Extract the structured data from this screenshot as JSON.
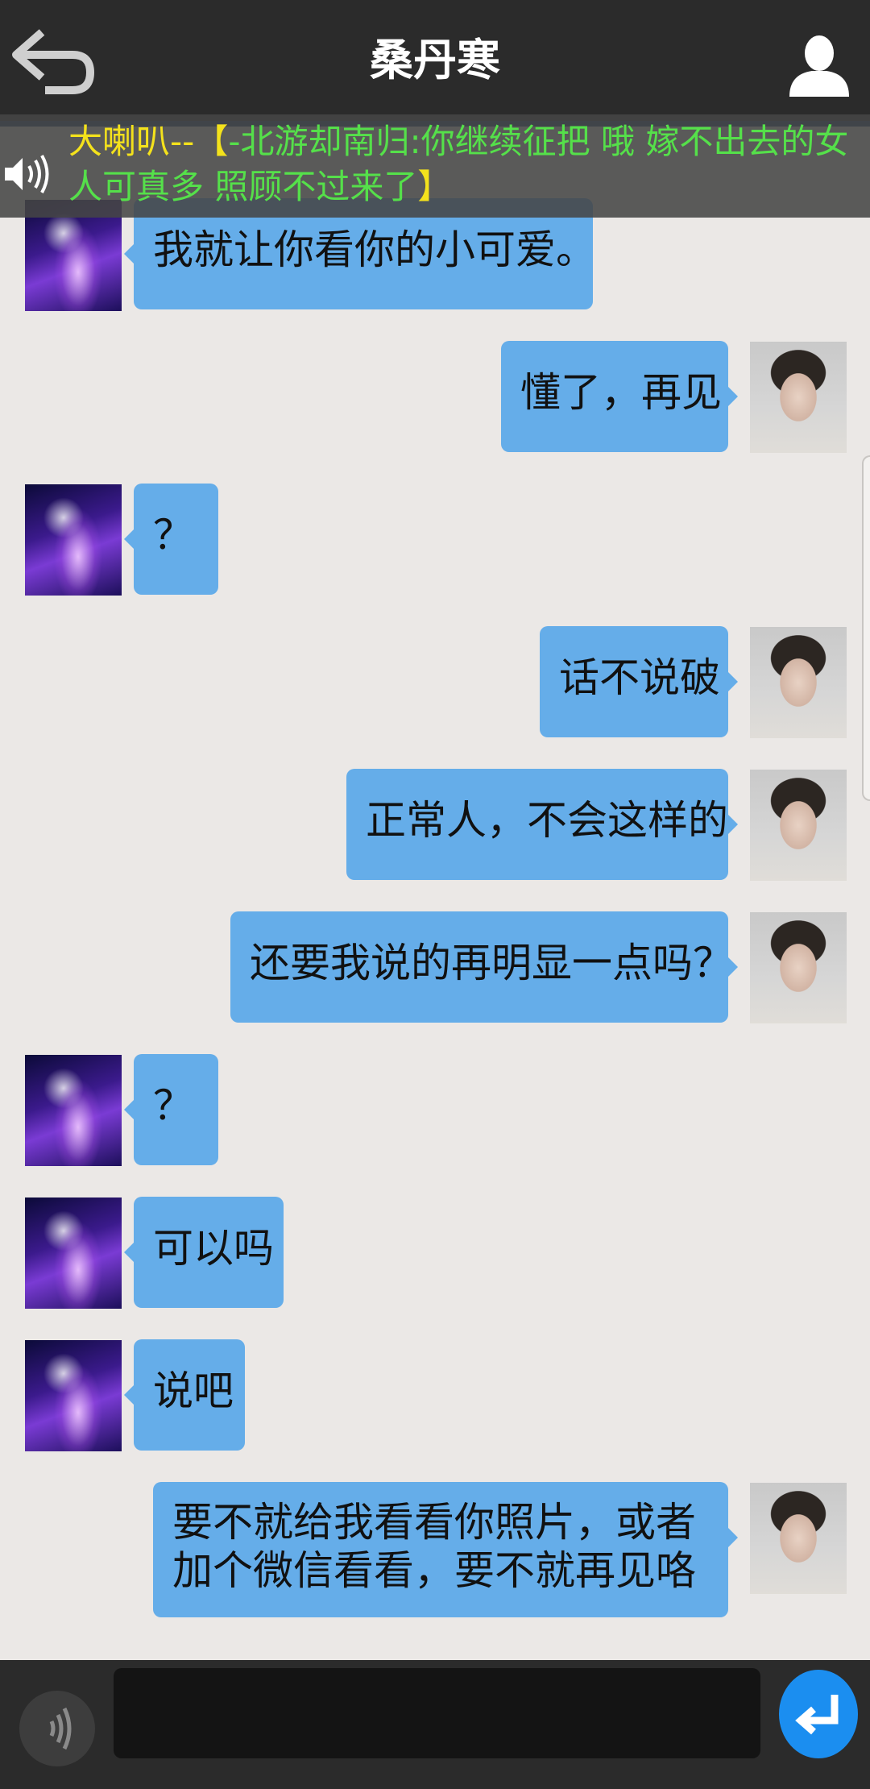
{
  "header": {
    "title": "桑丹寒",
    "back_icon": "back-arrow-icon",
    "profile_icon": "user-profile-icon"
  },
  "banner": {
    "prefix": "大喇叭--",
    "open_bracket": "【",
    "message": "-北游却南归:你继续征把 哦 嫁不出去的女人可真多 照顾不过来了",
    "close_bracket": "】",
    "icon": "speaker-icon"
  },
  "messages": [
    {
      "side": "left",
      "text": "我就让你看你的小可爱。"
    },
    {
      "side": "right",
      "text": "懂了，再见"
    },
    {
      "side": "left",
      "text": "？"
    },
    {
      "side": "right",
      "text": "话不说破"
    },
    {
      "side": "right",
      "text": "正常人，不会这样的"
    },
    {
      "side": "right",
      "text": "还要我说的再明显一点吗？"
    },
    {
      "side": "left",
      "text": "？"
    },
    {
      "side": "left",
      "text": "可以吗"
    },
    {
      "side": "left",
      "text": "说吧"
    },
    {
      "side": "right",
      "text": "要不就给我看看你照片，或者加个微信看看，要不就再见咯"
    }
  ],
  "input": {
    "value": "",
    "placeholder": "",
    "voice_icon": "voice-input-icon",
    "send_icon": "send-return-icon"
  },
  "colors": {
    "bubble": "#65ade9",
    "chat_bg": "#ebe8e6",
    "bar_bg": "#2b2b2b",
    "banner_prefix": "#f4e21c",
    "banner_text": "#55e04a",
    "send_button": "#1b8ef0"
  }
}
